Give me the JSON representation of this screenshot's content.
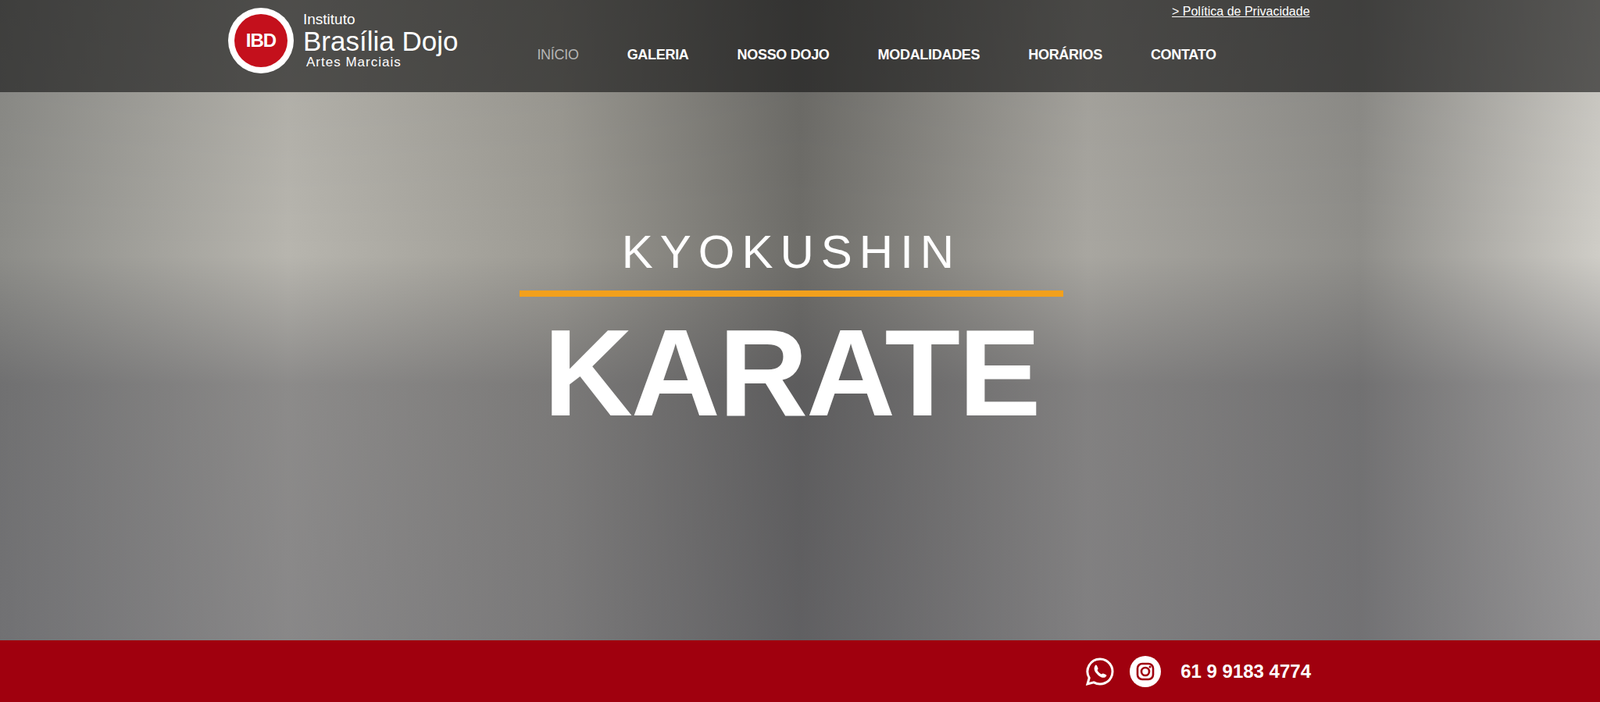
{
  "header": {
    "logo": {
      "mark": "IBD",
      "line1": "Instituto",
      "line2": "Brasília Dojo",
      "line3": "Artes Marciais"
    },
    "nav": [
      {
        "label": "INÍCIO",
        "selected": true
      },
      {
        "label": "GALERIA",
        "selected": false
      },
      {
        "label": "NOSSO DOJO",
        "selected": false
      },
      {
        "label": "MODALIDADES",
        "selected": false
      },
      {
        "label": "HORÁRIOS",
        "selected": false
      },
      {
        "label": "CONTATO",
        "selected": false
      }
    ],
    "privacy_link": "> Política de Privacidade"
  },
  "hero": {
    "kicker": "KYOKUSHIN",
    "title": "KARATE"
  },
  "footer": {
    "phone": "61 9 9183 4774"
  }
}
